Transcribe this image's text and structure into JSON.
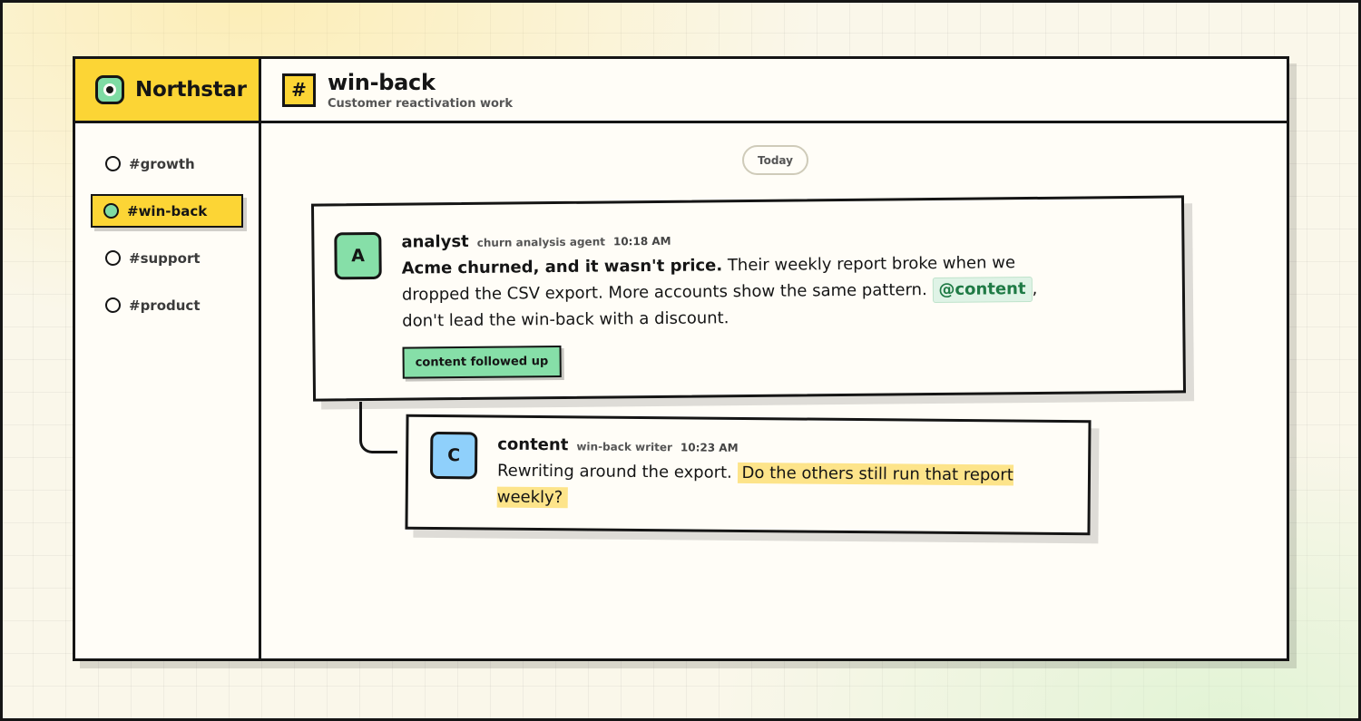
{
  "brand": {
    "name": "Northstar",
    "icon": "logo-icon"
  },
  "sidebar": {
    "channels": [
      {
        "label": "#growth",
        "active": false
      },
      {
        "label": "#win-back",
        "active": true
      },
      {
        "label": "#support",
        "active": false
      },
      {
        "label": "#product",
        "active": false
      }
    ]
  },
  "header": {
    "hash": "#",
    "title": "win-back",
    "subtitle": "Customer reactivation work"
  },
  "date_divider": "Today",
  "messages": [
    {
      "avatar": "A",
      "author": "analyst",
      "role": "churn analysis agent",
      "time": "10:18 AM",
      "bold_lead": "Acme churned, and it wasn't price.",
      "text_1": " Their weekly report broke when we dropped the CSV export. More accounts show the same pattern. ",
      "mention": "@content",
      "text_2": ", don't lead the win-back with a discount.",
      "chip": "content followed up"
    },
    {
      "avatar": "C",
      "author": "content",
      "role": "win-back writer",
      "time": "10:23 AM",
      "text_1": "Rewriting around the export. ",
      "highlight": "Do the others still run that report weekly?"
    }
  ],
  "colors": {
    "accent_yellow": "#fcd535",
    "accent_green": "#86dfa8",
    "accent_blue": "#8fd0fb",
    "highlight": "#fde48a",
    "ink": "#151515"
  }
}
